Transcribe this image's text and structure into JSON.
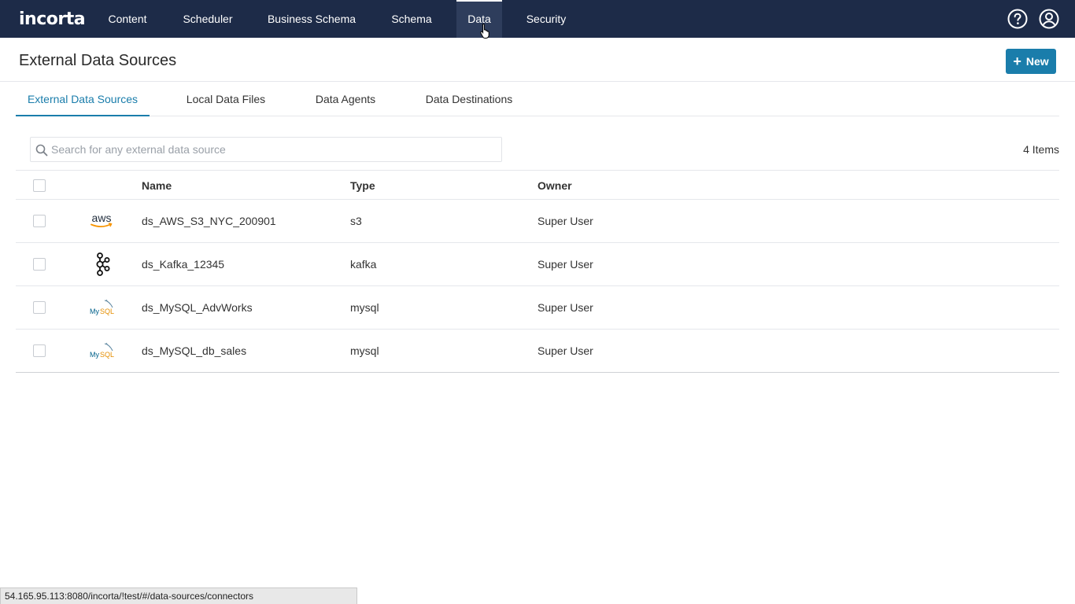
{
  "nav": {
    "logo": "incorta",
    "items": [
      {
        "label": "Content"
      },
      {
        "label": "Scheduler"
      },
      {
        "label": "Business Schema"
      },
      {
        "label": "Schema"
      },
      {
        "label": "Data",
        "active": true
      },
      {
        "label": "Security"
      }
    ],
    "icons": [
      "help-icon",
      "user-account-icon"
    ]
  },
  "header": {
    "title": "External Data Sources",
    "new_label": "New"
  },
  "tabs": [
    {
      "label": "External Data Sources",
      "active": true
    },
    {
      "label": "Local Data Files"
    },
    {
      "label": "Data Agents"
    },
    {
      "label": "Data Destinations"
    }
  ],
  "search": {
    "placeholder": "Search for any external data source",
    "value": ""
  },
  "items_count": "4 Items",
  "table": {
    "columns": [
      "Name",
      "Type",
      "Owner"
    ],
    "rows": [
      {
        "icon": "aws-icon",
        "name": "ds_AWS_S3_NYC_200901",
        "type": "s3",
        "owner": "Super User"
      },
      {
        "icon": "kafka-icon",
        "name": "ds_Kafka_12345",
        "type": "kafka",
        "owner": "Super User"
      },
      {
        "icon": "mysql-icon",
        "name": "ds_MySQL_AdvWorks",
        "type": "mysql",
        "owner": "Super User"
      },
      {
        "icon": "mysql-icon",
        "name": "ds_MySQL_db_sales",
        "type": "mysql",
        "owner": "Super User"
      }
    ]
  },
  "status_url": "54.165.95.113:8080/incorta/!test/#/data-sources/connectors",
  "colors": {
    "nav_bg": "#1d2b48",
    "accent": "#1a7dab",
    "border": "#e5e7eb"
  }
}
